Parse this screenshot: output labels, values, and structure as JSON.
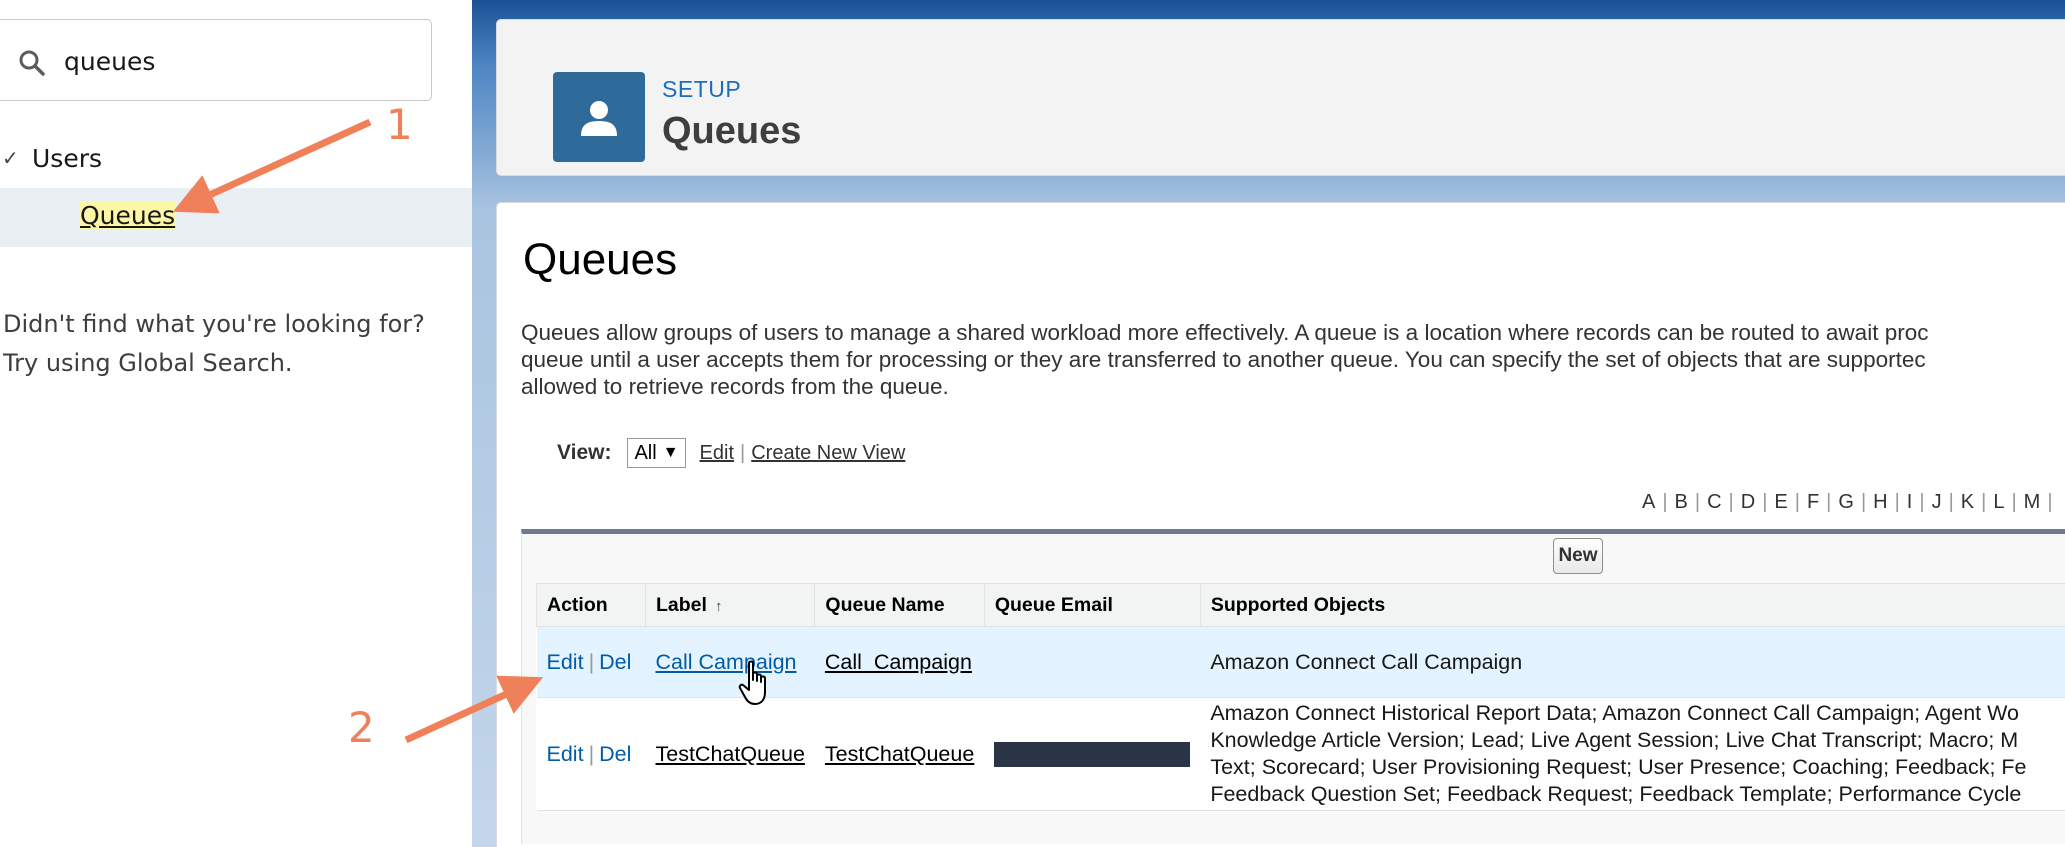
{
  "sidebar": {
    "search": {
      "value": "queues",
      "icon": "search-icon"
    },
    "tree": {
      "parent_label": "Users",
      "child_label": "Queues"
    },
    "not_found": {
      "line1": "Didn't find what you're looking for?",
      "line2": "Try using Global Search."
    }
  },
  "header": {
    "eyebrow": "SETUP",
    "title": "Queues",
    "icon": "user-icon"
  },
  "content": {
    "heading": "Queues",
    "description": [
      "Queues allow groups of users to manage a shared workload more effectively. A queue is a location where records can be routed to await proc",
      "queue until a user accepts them for processing or they are transferred to another queue. You can specify the set of objects that are supportec",
      "allowed to retrieve records from the queue."
    ],
    "view": {
      "label": "View:",
      "selected": "All",
      "edit_link": "Edit",
      "create_link": "Create New View"
    },
    "alphabet": [
      "A",
      "B",
      "C",
      "D",
      "E",
      "F",
      "G",
      "H",
      "I",
      "J",
      "K",
      "L",
      "M"
    ],
    "new_button": "New",
    "table": {
      "headers": [
        "Action",
        "Label",
        "Queue Name",
        "Queue Email",
        "Supported Objects"
      ],
      "rows": [
        {
          "edit": "Edit",
          "del": "Del",
          "label": "Call Campaign",
          "queue_name": "Call_Campaign",
          "queue_email": "",
          "objects": [
            "Amazon Connect Call Campaign"
          ]
        },
        {
          "edit": "Edit",
          "del": "Del",
          "label": "TestChatQueue",
          "queue_name": "TestChatQueue",
          "queue_email": "",
          "objects": [
            "Amazon Connect Historical Report Data; Amazon Connect Call Campaign; Agent Wo",
            "Knowledge Article Version; Lead; Live Agent Session; Live Chat Transcript; Macro; M",
            "Text; Scorecard; User Provisioning Request; User Presence; Coaching; Feedback; Fe",
            "Feedback Question Set; Feedback Request; Feedback Template; Performance Cycle"
          ]
        }
      ]
    }
  },
  "annotations": {
    "step1": "1",
    "step2": "2",
    "color": "#f0805a"
  },
  "colors": {
    "link": "#015ba7",
    "header_icon_bg": "#2f6b9a",
    "eyebrow": "#1a6ec2",
    "highlight": "#fdf7a6",
    "selected_row": "#e3f3ff"
  }
}
